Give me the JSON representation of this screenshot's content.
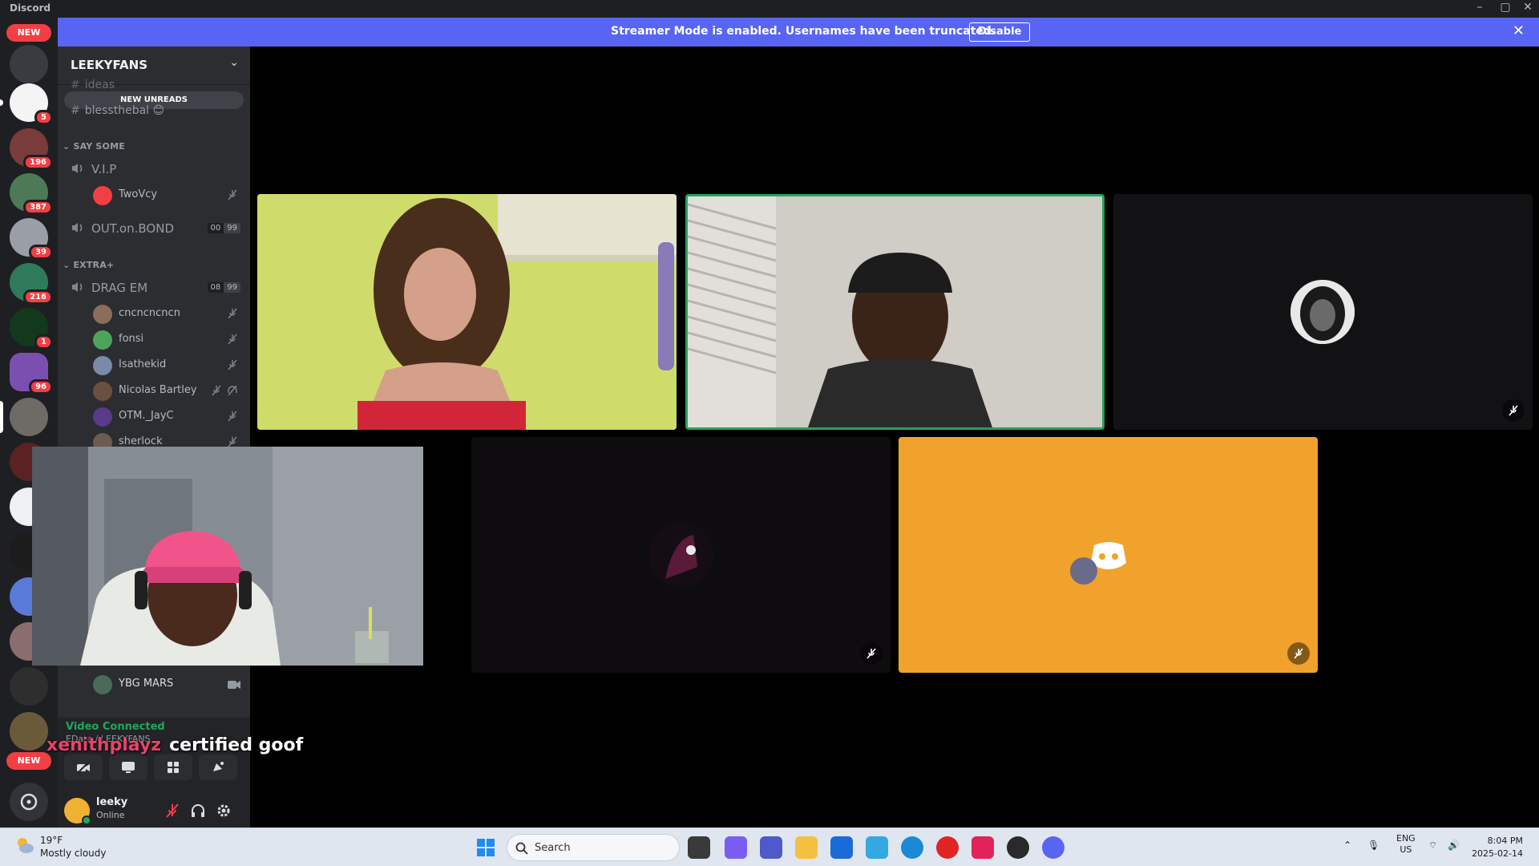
{
  "app_title": "Discord",
  "banner": {
    "text": "Streamer Mode is enabled. Usernames have been truncated.",
    "button": "Disable",
    "close": "✕"
  },
  "servers": {
    "new_top": "NEW",
    "new_bottom": "NEW",
    "badges": [
      "5",
      "196",
      "387",
      "39",
      "216",
      "1",
      "96"
    ]
  },
  "sidebar": {
    "guild_name": "LEEKYFANS",
    "new_unreads": "NEW UNREADS",
    "channels": [
      {
        "name": "ideas"
      },
      {
        "name": "blessthebal 😊"
      }
    ],
    "categories": [
      {
        "name": "SAY SOME"
      },
      {
        "name": "EXTRA+"
      }
    ],
    "voice_channels": [
      {
        "name": "V.I.P",
        "members": [
          {
            "name": "TwoVcy"
          }
        ]
      },
      {
        "name": "OUT.on.BOND",
        "count_a": "00",
        "count_b": "99"
      },
      {
        "name": "DRAG EM",
        "count_a": "08",
        "count_b": "99",
        "members": [
          {
            "name": "cncncncncn"
          },
          {
            "name": "fonsi"
          },
          {
            "name": "Isathekid"
          },
          {
            "name": "Nicolas Bartley"
          },
          {
            "name": "OTM._JayC"
          },
          {
            "name": "sherlock"
          }
        ]
      }
    ],
    "pip_user": "YBG MARS"
  },
  "voice_panel": {
    "status": "Video Connected",
    "sub": "EData / LEEKYFANS"
  },
  "user_panel": {
    "name": "leeky",
    "status": "Online"
  },
  "overlay": {
    "username": "xenithplayz",
    "message": "certified goof"
  },
  "taskbar": {
    "temp": "19°F",
    "condition": "Mostly cloudy",
    "search_placeholder": "Search",
    "lang_top": "ENG",
    "lang_bottom": "US",
    "time": "8:04 PM",
    "date": "2025-02-14"
  },
  "colors": {
    "blurple": "#5865f2",
    "speaking_green": "#23a55a",
    "orange_tile": "#f0a22c",
    "badge_red": "#f23f43"
  }
}
